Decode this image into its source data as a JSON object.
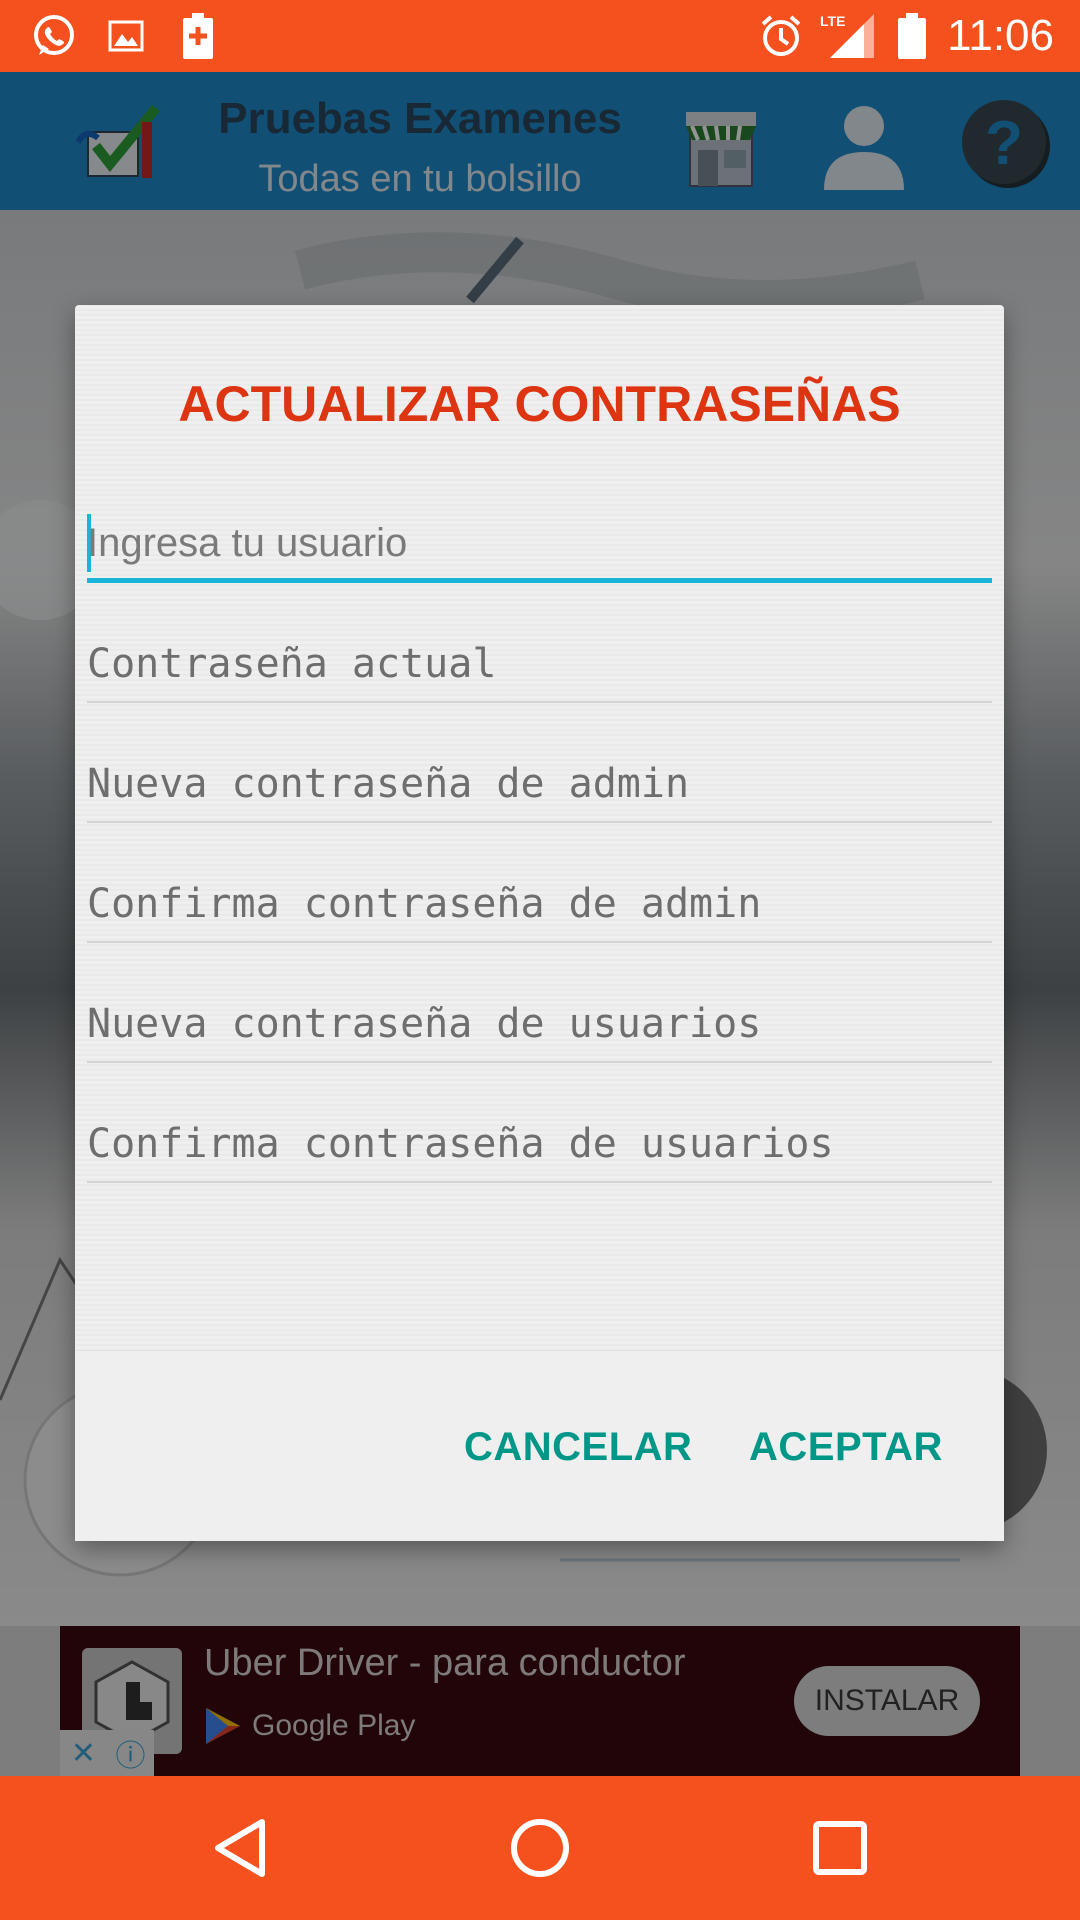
{
  "status_bar": {
    "time": "11:06",
    "network": "LTE",
    "icons": [
      "whatsapp-icon",
      "image-icon",
      "battery-saver-icon",
      "alarm-icon",
      "signal-icon",
      "battery-icon"
    ]
  },
  "app_bar": {
    "title": "Pruebas Examenes",
    "subtitle": "Todas en tu bolsillo",
    "icons": [
      "app-logo",
      "store-icon",
      "user-icon",
      "help-icon"
    ]
  },
  "dialog": {
    "title": "ACTUALIZAR CONTRASEÑAS",
    "fields": [
      {
        "placeholder": "Ingresa tu usuario"
      },
      {
        "placeholder": "Contraseña actual"
      },
      {
        "placeholder": "Nueva contraseña de admin"
      },
      {
        "placeholder": "Confirma contraseña de admin"
      },
      {
        "placeholder": "Nueva contraseña de usuarios"
      },
      {
        "placeholder": "Confirma contraseña de usuarios"
      }
    ],
    "cancel_label": "CANCELAR",
    "accept_label": "ACEPTAR"
  },
  "ad": {
    "title": "Uber Driver - para conductor",
    "store": "Google Play",
    "install_label": "INSTALAR",
    "close_symbol": "✕",
    "info_symbol": "ⓘ"
  },
  "colors": {
    "status_bar": "#f4511e",
    "app_bar": "#1e88c9",
    "dialog_title": "#dd3412",
    "accent": "#19b5d9",
    "button_text": "#009688"
  }
}
